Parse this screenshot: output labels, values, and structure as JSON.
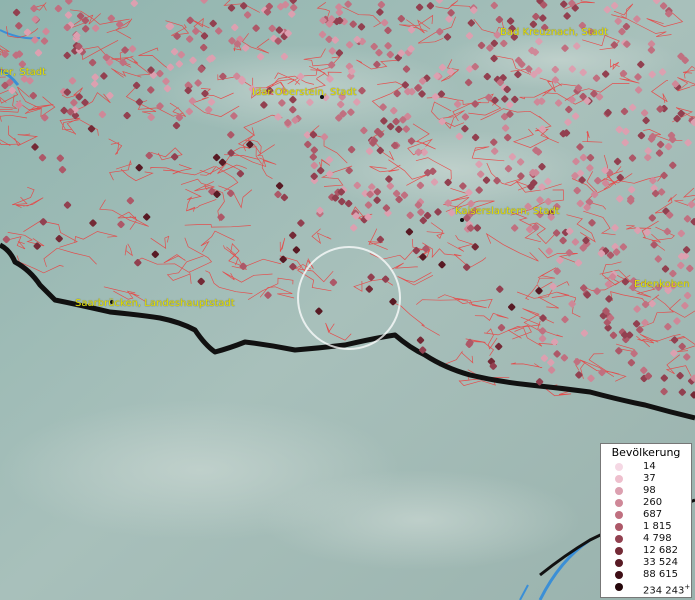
{
  "cities": [
    {
      "label": "ier, Stadt"
    },
    {
      "label": "Bad Kreuznach, Stadt"
    },
    {
      "label": "Idar-Oberstein, Stadt"
    },
    {
      "label": "Kaiserslautern, Stadt"
    },
    {
      "label": "Saarbrücken, Landeshauptstadt"
    },
    {
      "label": "Edenkoben"
    }
  ],
  "legend": {
    "title": "Bevölkerung",
    "classes": [
      {
        "label": "14",
        "color": "#f5d8e4"
      },
      {
        "label": "37",
        "color": "#eebfcd"
      },
      {
        "label": "98",
        "color": "#dca0b0"
      },
      {
        "label": "260",
        "color": "#cf8898"
      },
      {
        "label": "687",
        "color": "#c07080"
      },
      {
        "label": "1 815",
        "color": "#ad5868"
      },
      {
        "label": "4 798",
        "color": "#924050"
      },
      {
        "label": "12 682",
        "color": "#742a36"
      },
      {
        "label": "33 524",
        "color": "#581a24"
      },
      {
        "label": "88 615",
        "color": "#3e0e16"
      },
      {
        "label": "234 243",
        "color": "#24060a",
        "suffix": "+"
      }
    ]
  },
  "colors": {
    "border_lines": "#ee3b3b",
    "state_border": "#111111",
    "city_label": "#e8e400",
    "cursor_ring": "#ffffff"
  }
}
